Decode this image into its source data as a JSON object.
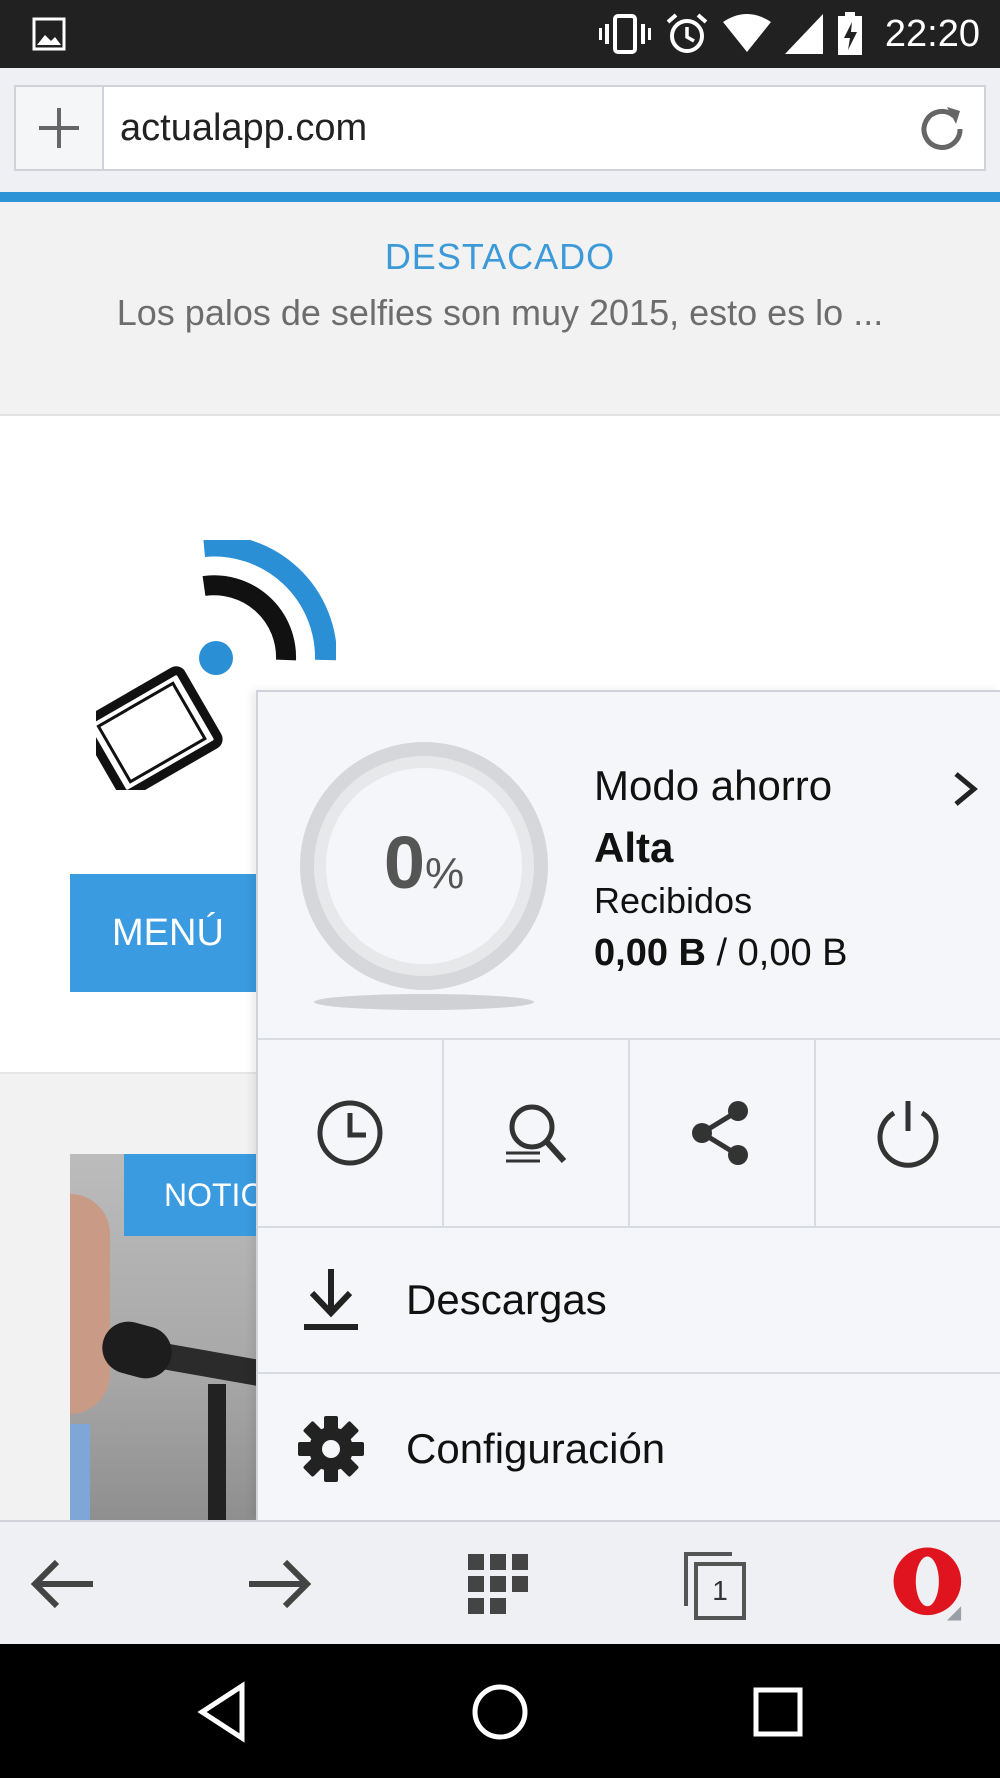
{
  "status_bar": {
    "time": "22:20",
    "icons": [
      "image-notification-icon",
      "vibrate-icon",
      "alarm-icon",
      "wifi-icon",
      "cell-signal-icon",
      "battery-charging-icon"
    ]
  },
  "address_bar": {
    "url": "actualapp.com",
    "icons": [
      "plus-icon",
      "reload-icon"
    ]
  },
  "featured": {
    "tag": "DESTACADO",
    "headline": "Los palos de selfies son muy 2015, esto es lo ..."
  },
  "page": {
    "menu_label": "MENÚ",
    "news_tag": "NOTICIAS"
  },
  "opera_menu": {
    "savings": {
      "percent_value": "0",
      "percent_sign": "%",
      "title": "Modo ahorro",
      "level": "Alta",
      "received_label": "Recibidos",
      "received_amount": "0,00 B",
      "separator": " / ",
      "total_amount": "0,00 B"
    },
    "quick_actions": [
      "history-icon",
      "find-in-page-icon",
      "share-icon",
      "power-icon"
    ],
    "items": [
      {
        "label": "Descargas",
        "icon": "download-icon"
      },
      {
        "label": "Configuración",
        "icon": "settings-gear-icon"
      }
    ]
  },
  "toolbar": {
    "tabs_count": "1",
    "icons": [
      "back-arrow-icon",
      "forward-arrow-icon",
      "speed-dial-icon",
      "tabs-icon",
      "opera-logo-icon"
    ]
  },
  "colors": {
    "accent": "#3a9be0",
    "progress": "#2c93d6",
    "opera_red": "#e0141e"
  }
}
